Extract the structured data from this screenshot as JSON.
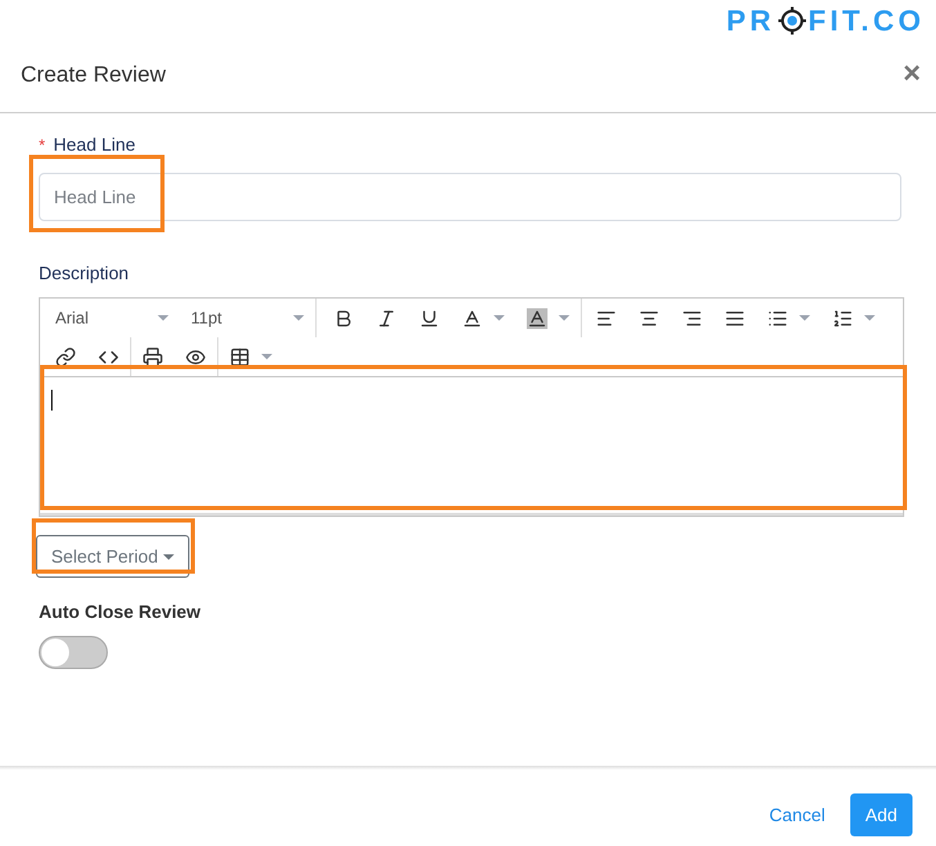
{
  "logo": {
    "left": "PR",
    "right": "FIT.CO"
  },
  "dialog": {
    "title": "Create Review",
    "close": "×"
  },
  "headline": {
    "required_mark": "*",
    "label": "Head Line",
    "placeholder": "Head Line"
  },
  "description": {
    "label": "Description",
    "font": "Arial",
    "size": "11pt"
  },
  "period": {
    "label": "Select Period"
  },
  "auto_close": {
    "label": "Auto Close Review",
    "on": false
  },
  "buttons": {
    "cancel": "Cancel",
    "add": "Add"
  }
}
